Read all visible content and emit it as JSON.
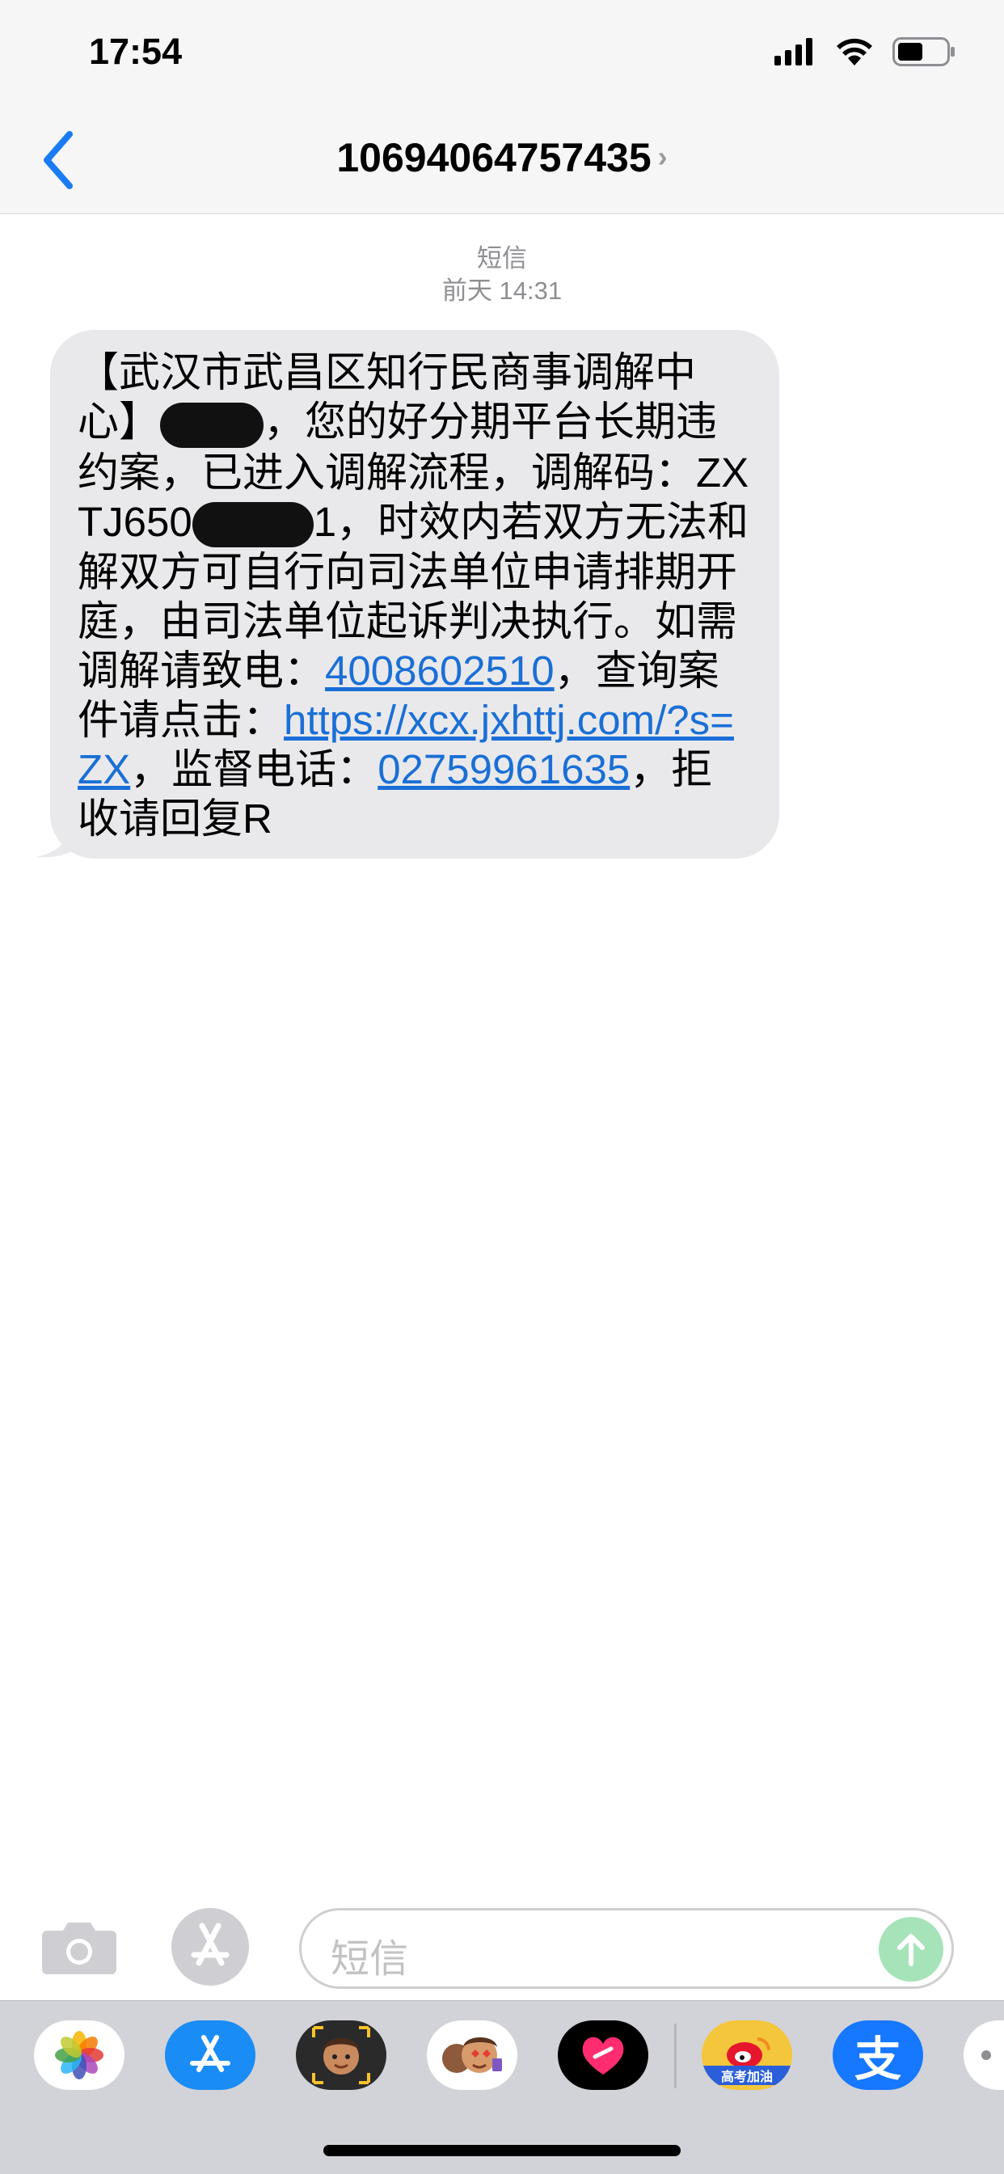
{
  "status_bar": {
    "time": "17:54"
  },
  "nav": {
    "contact": "10694064757435",
    "chevron": "›"
  },
  "thread": {
    "service": "短信",
    "timestamp": "前天 14:31"
  },
  "message": {
    "part1": "【武汉市武昌区知行民商事调解中心】",
    "part2": "，您的好分期平台长期违约案，已进入调解流程，调解码：ZXTJ650",
    "part3": "1，时效内若双方无法和解双方可自行向司法单位申请排期开庭，由司法单位起诉判决执行。如需调解请致电：",
    "phone": "4008602510",
    "part4": "，查询案件请点击：",
    "link": "https://xcx.jxhttj.com/?s=ZX",
    "part5": "，监督电话：",
    "supervise_phone": "02759961635",
    "part6": "，拒收请回复R"
  },
  "composer": {
    "placeholder": "短信"
  },
  "dock": {
    "apps": [
      "photos-app",
      "app-store-app",
      "memoji-app",
      "animoji-app",
      "digital-touch-app",
      "weibo-app",
      "alipay-app",
      "more-apps"
    ],
    "weibo_badge": "高考加油",
    "alipay_glyph": "支"
  },
  "colors": {
    "link": "#1a6fd6",
    "bubble": "#e9e9eb",
    "accent": "#1a7cf5"
  }
}
